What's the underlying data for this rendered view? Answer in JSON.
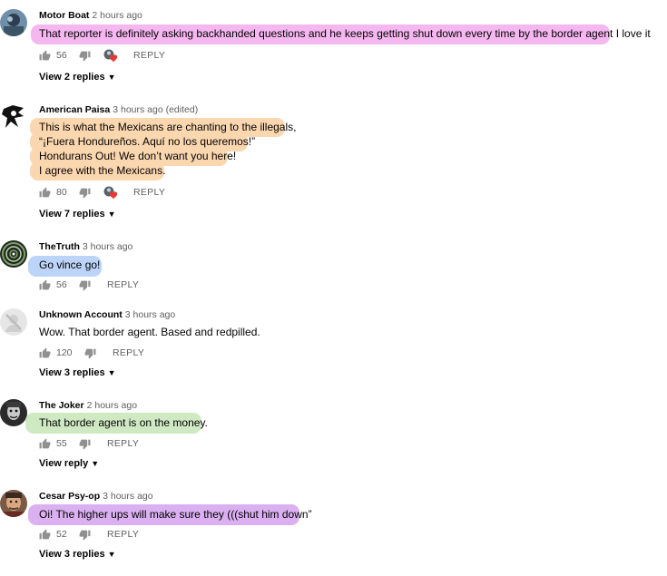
{
  "comments": [
    {
      "author": "Motor Boat",
      "time": "2 hours ago",
      "lines": [
        "That reporter is definitely asking backhanded questions and he keeps getting shut down every time by the border agent I love it"
      ],
      "likes": "56",
      "reply_label": "REPLY",
      "replies_label": "View 2 replies",
      "creator_heart": true
    },
    {
      "author": "American Paisa",
      "time": "3 hours ago (edited)",
      "lines": [
        "This is what the Mexicans are chanting to the illegals,",
        "“¡Fuera Hondureños. Aquí no los queremos!”",
        "Hondurans Out! We don’t want you here!",
        "I agree with the Mexicans."
      ],
      "likes": "80",
      "reply_label": "REPLY",
      "replies_label": "View 7 replies",
      "creator_heart": true
    },
    {
      "author": "TheTruth",
      "time": "3 hours ago",
      "lines": [
        "Go vince go!"
      ],
      "likes": "56",
      "reply_label": "REPLY",
      "creator_heart": false
    },
    {
      "author": "Unknown Account",
      "time": "3 hours ago",
      "lines": [
        "Wow. That border agent. Based and redpilled."
      ],
      "likes": "120",
      "reply_label": "REPLY",
      "replies_label": "View 3 replies",
      "creator_heart": false
    },
    {
      "author": "The Joker",
      "time": "2 hours ago",
      "lines": [
        "That border agent is on the money."
      ],
      "likes": "55",
      "reply_label": "REPLY",
      "replies_label": "View reply",
      "creator_heart": false
    },
    {
      "author": "Cesar Psy-op",
      "time": "3 hours ago",
      "lines": [
        "Oi! The higher ups will make sure they (((shut him down”"
      ],
      "likes": "52",
      "reply_label": "REPLY",
      "replies_label": "View 3 replies",
      "creator_heart": false
    }
  ],
  "colors": {
    "highlight_pink": "#f5b7ef",
    "highlight_orange": "#fbd7b0",
    "highlight_blue": "#bcd4f7",
    "highlight_green": "#cfe9c3",
    "highlight_purple": "#dbb0f0",
    "heart_red": "#e53935"
  },
  "icons": {
    "like": "thumb-up-icon",
    "dislike": "thumb-down-icon",
    "chevron": "chevron-down-icon",
    "creator_heart": "creator-heart-icon"
  }
}
